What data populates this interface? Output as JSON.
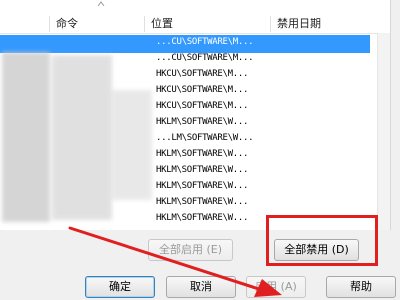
{
  "table": {
    "columns": [
      "命令",
      "位置",
      "禁用日期"
    ],
    "rows": [
      {
        "location": "...CU\\SOFTWARE\\M...",
        "command": "",
        "selected": true
      },
      {
        "location": "...CU\\SOFTWARE\\M...",
        "command": "",
        "selected": false
      },
      {
        "location": "HKCU\\SOFTWARE\\M...",
        "command": "",
        "selected": false
      },
      {
        "location": "HKCU\\SOFTWARE\\M...",
        "command": "",
        "selected": false
      },
      {
        "location": "HKCU\\SOFTWARE\\M...",
        "command": "",
        "selected": false
      },
      {
        "location": "HKLM\\SOFTWARE\\W...",
        "command": "",
        "selected": false
      },
      {
        "location": "...LM\\SOFTWARE\\W...",
        "command": "",
        "selected": false
      },
      {
        "location": "HKLM\\SOFTWARE\\W...",
        "command": "",
        "selected": false
      },
      {
        "location": "HKLM\\SOFTWARE\\W...",
        "command": "",
        "selected": false
      },
      {
        "location": "HKLM\\SOFTWARE\\W...",
        "command": "",
        "selected": false
      },
      {
        "location": "HKLM\\SOFTWARE\\W...",
        "command": "",
        "selected": false
      },
      {
        "location": "HKLM\\SOFTWARE\\W...",
        "command": "",
        "selected": false
      }
    ]
  },
  "buttons": {
    "enable_all": "全部启用 (E)",
    "disable_all": "全部禁用 (D)",
    "ok": "确定",
    "cancel": "取消",
    "apply": "应用 (A)",
    "help": "帮助"
  },
  "colors": {
    "selection": "#3399ff",
    "highlight_box": "#e02020",
    "arrow": "#e02020"
  }
}
